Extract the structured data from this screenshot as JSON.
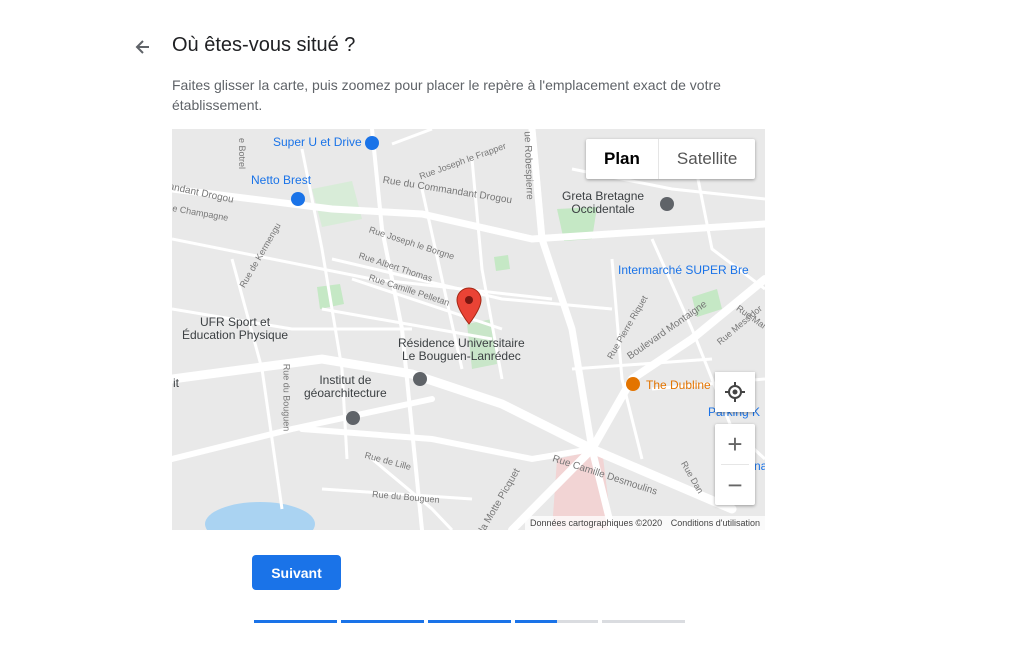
{
  "header": {
    "title": "Où êtes-vous situé ?",
    "description": "Faites glisser la carte, puis zoomez pour placer le repère à l'emplacement exact de votre établissement."
  },
  "map": {
    "map_type": {
      "plan_label": "Plan",
      "satellite_label": "Satellite",
      "selected": "Plan"
    },
    "places": {
      "super_u": "Super U et Drive",
      "netto": "Netto Brest",
      "greta_line1": "Greta Bretagne",
      "greta_line2": "Occidentale",
      "intermarche": "Intermarché SUPER Bre",
      "ufr_line1": "UFR Sport et",
      "ufr_line2": "Éducation Physique",
      "residence_line1": "Résidence Universitaire",
      "residence_line2": "Le Bouguen-Lanrédec",
      "institut_line1": "Institut de",
      "institut_line2": "géoarchitecture",
      "dubline": "The Dubline",
      "parking": "Parking K",
      "it_fragment": "it",
      "na_fragment": "na"
    },
    "streets": {
      "commandant_drogou": "Rue du Commandant Drogou",
      "andant_drogou": "andant Drogou",
      "champagne": "e Champagne",
      "joseph_frapper": "Rue Joseph le Frapper",
      "joseph_borgne": "Rue Joseph le Borgne",
      "albert_thomas": "Rue Albert Thomas",
      "camille_pelletan": "Rue Camille Pelletan",
      "robespierre": "ue Robespierre",
      "botrel": "e Botrel",
      "kermengu": "Rue de Kermengu",
      "bouguen_v": "Rue du Bouguen",
      "lille": "Rue de Lille",
      "bouguen": "Rue du Bouguen",
      "motte_picquet": "la Motte Picquet",
      "camille_desmoulins": "Rue Camille Desmoulins",
      "danton": "Rue Dan",
      "pierre_riquet": "Rue Pierre Riquet",
      "montaigne": "Boulevard Montaigne",
      "messidor": "Rue Messidor",
      "rue_mar": "Rue Mar"
    },
    "attribution": "Données cartographiques ©2020",
    "terms": "Conditions d'utilisation",
    "zoom_in": "+",
    "zoom_out": "−",
    "colors": {
      "poi_blue": "#1a73e8",
      "pin_red": "#ea4335",
      "park_green": "#c5e8c5"
    }
  },
  "actions": {
    "next_label": "Suivant"
  },
  "progress": {
    "segments": [
      1,
      1,
      1,
      0.5,
      0
    ]
  },
  "colors": {
    "accent": "#1a73e8",
    "track": "#dadce0"
  }
}
